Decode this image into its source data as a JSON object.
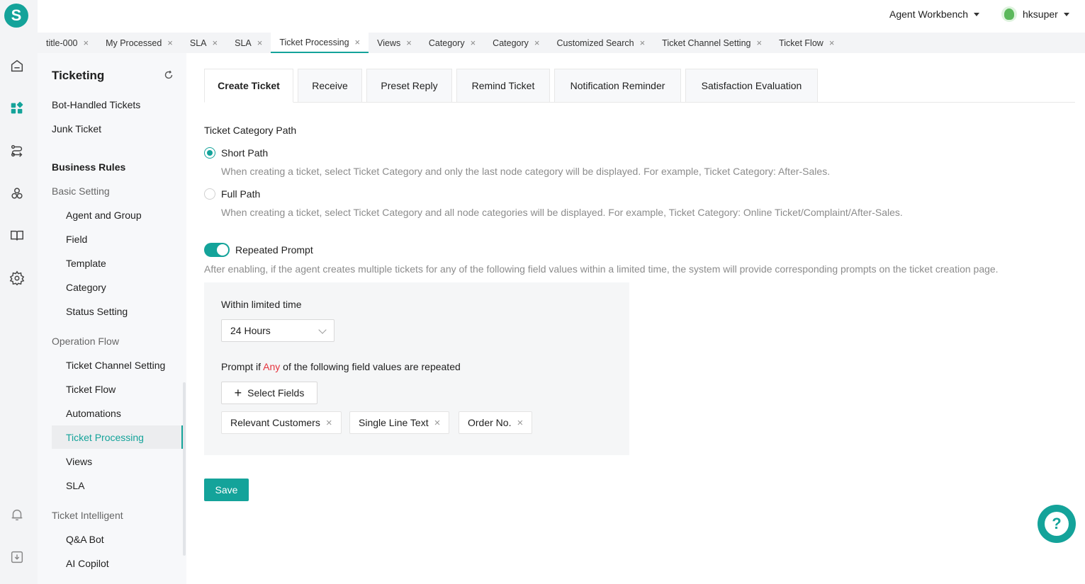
{
  "brand": {
    "logo_letter": "S",
    "accent": "#14a39a"
  },
  "rail": {
    "icons": [
      "home-icon",
      "apps-icon",
      "flow-icon",
      "users-icon",
      "book-icon",
      "gear-icon",
      "bell-icon",
      "download-icon"
    ]
  },
  "topbar": {
    "workbench_label": "Agent Workbench",
    "username": "hksuper"
  },
  "tabs": [
    {
      "label": "title-000"
    },
    {
      "label": "My Processed"
    },
    {
      "label": "SLA"
    },
    {
      "label": "SLA"
    },
    {
      "label": "Ticket Processing"
    },
    {
      "label": "Views"
    },
    {
      "label": "Category"
    },
    {
      "label": "Category"
    },
    {
      "label": "Customized Search"
    },
    {
      "label": "Ticket Channel Setting"
    },
    {
      "label": "Ticket Flow"
    }
  ],
  "tab_close_glyph": "×",
  "sidebar": {
    "title": "Ticketing",
    "items": {
      "bot_handled": "Bot-Handled Tickets",
      "junk": "Junk Ticket",
      "business_rules": "Business Rules",
      "basic_setting": "Basic Setting",
      "agent_group": "Agent and Group",
      "field": "Field",
      "template": "Template",
      "category": "Category",
      "status_setting": "Status Setting",
      "operation_flow": "Operation Flow",
      "ticket_channel_setting": "Ticket Channel Setting",
      "ticket_flow": "Ticket Flow",
      "automations": "Automations",
      "ticket_processing": "Ticket Processing",
      "views": "Views",
      "sla": "SLA",
      "ticket_intelligent": "Ticket Intelligent",
      "qa_bot": "Q&A Bot",
      "ai_copilot": "AI Copilot"
    }
  },
  "content_tabs": [
    {
      "label": "Create Ticket"
    },
    {
      "label": "Receive"
    },
    {
      "label": "Preset Reply"
    },
    {
      "label": "Remind Ticket"
    },
    {
      "label": "Notification Reminder"
    },
    {
      "label": "Satisfaction Evaluation"
    }
  ],
  "form": {
    "category_path_label": "Ticket Category Path",
    "short_path_label": "Short Path",
    "short_path_desc": "When creating a ticket, select Ticket Category and only the last node category will be displayed. For example, Ticket Category: After-Sales.",
    "full_path_label": "Full Path",
    "full_path_desc": "When creating a ticket, select Ticket Category and all node categories will be displayed. For example, Ticket Category: Online Ticket/Complaint/After-Sales.",
    "repeated_prompt_label": "Repeated Prompt",
    "repeated_prompt_desc": "After enabling, if the agent creates multiple tickets for any of the following field values within a limited time, the system will provide corresponding prompts on the ticket creation page.",
    "limited_time_label": "Within limited time",
    "limited_time_value": "24 Hours",
    "prompt_prefix": "Prompt if",
    "prompt_any": "Any",
    "prompt_suffix": "of the following field values are repeated",
    "select_fields_label": "Select Fields",
    "plus_glyph": "+",
    "chips": [
      "Relevant Customers",
      "Single Line Text",
      "Order No."
    ],
    "save_label": "Save"
  },
  "help_glyph": "?"
}
